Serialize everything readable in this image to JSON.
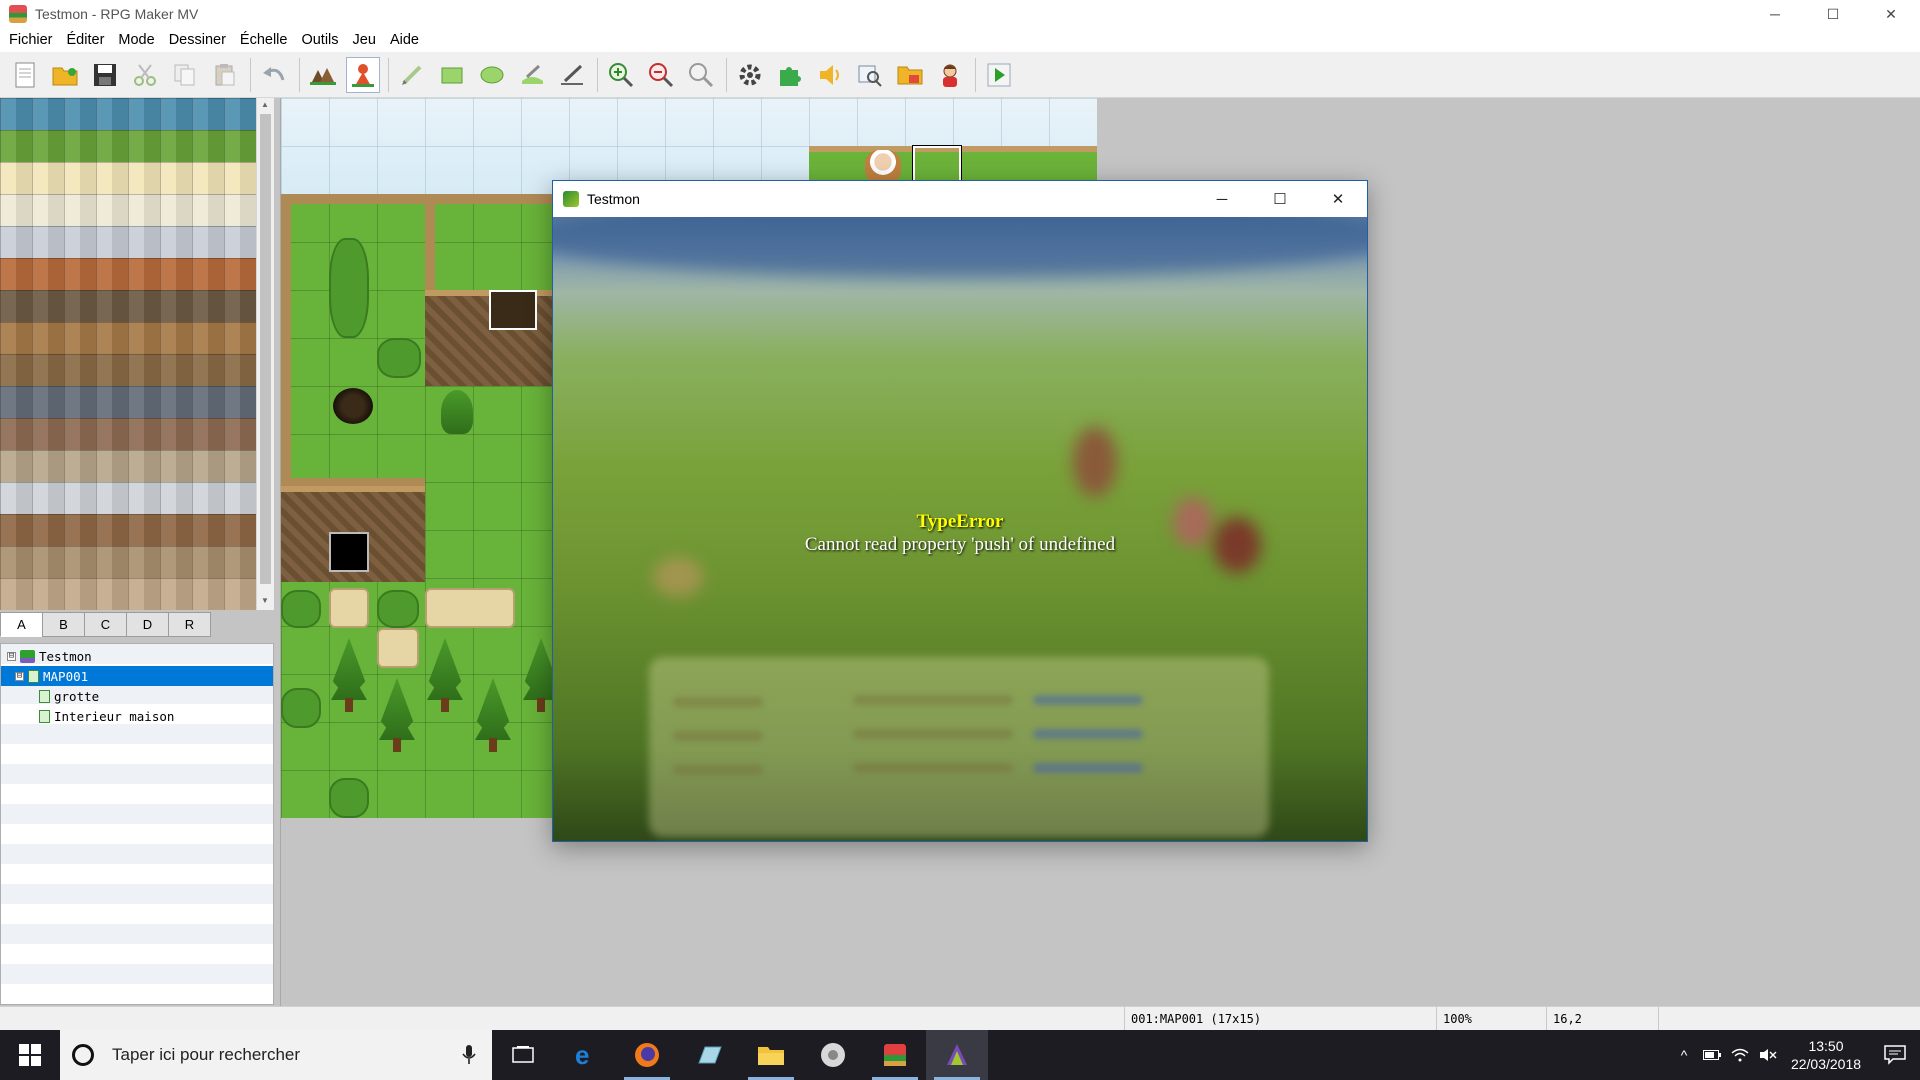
{
  "window": {
    "title": "Testmon - RPG Maker MV",
    "minimize": "─",
    "maximize": "☐",
    "close": "✕"
  },
  "menu": [
    "Fichier",
    "Éditer",
    "Mode",
    "Dessiner",
    "Échelle",
    "Outils",
    "Jeu",
    "Aide"
  ],
  "toolbar_icons": [
    "new-project-icon",
    "open-project-icon",
    "save-project-icon",
    "cut-icon",
    "copy-icon",
    "paste-icon",
    "undo-icon",
    "map-mode-icon",
    "event-mode-icon",
    "pencil-icon",
    "rectangle-icon",
    "ellipse-icon",
    "fill-icon",
    "shadow-pen-icon",
    "zoom-in-icon",
    "zoom-out-icon",
    "actual-size-icon",
    "database-icon",
    "plugin-manager-icon",
    "sound-test-icon",
    "event-searcher-icon",
    "resource-manager-icon",
    "character-generator-icon",
    "playtest-icon"
  ],
  "tileset_tabs": [
    "A",
    "B",
    "C",
    "D",
    "R"
  ],
  "tileset_active_tab": "A",
  "map_tree": [
    {
      "label": "Testmon",
      "level": 0,
      "type": "project",
      "expander": "⊟"
    },
    {
      "label": "MAP001",
      "level": 1,
      "type": "map",
      "expander": "⊟",
      "selected": true
    },
    {
      "label": "grotte",
      "level": 2,
      "type": "map"
    },
    {
      "label": "Interieur maison",
      "level": 2,
      "type": "map"
    }
  ],
  "game_window": {
    "title": "Testmon",
    "minimize": "─",
    "maximize": "☐",
    "close": "✕",
    "error_title": "TypeError",
    "error_message": "Cannot read property 'push' of undefined"
  },
  "statusbar": {
    "map_info": "001:MAP001 (17x15)",
    "zoom": "100%",
    "coords": "16,2"
  },
  "taskbar": {
    "search_placeholder": "Taper ici pour rechercher",
    "apps": [
      "task-view-icon",
      "edge-icon",
      "firefox-icon",
      "generic-app-icon",
      "file-explorer-icon",
      "media-app-icon",
      "rpg-maker-icon",
      "testmon-game-icon"
    ],
    "time": "13:50",
    "date": "22/03/2018"
  },
  "colors": {
    "selection": "#0078d7",
    "error_title": "#ffff00",
    "taskbar": "#1c1c22"
  }
}
